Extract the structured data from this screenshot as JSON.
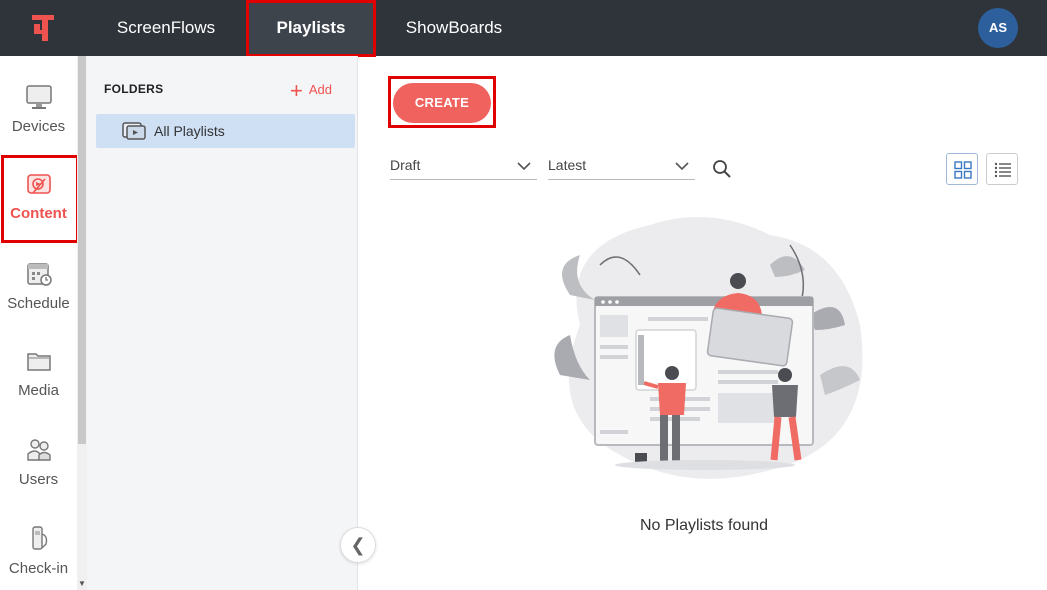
{
  "topbar": {
    "nav": [
      {
        "label": "ScreenFlows"
      },
      {
        "label": "Playlists"
      },
      {
        "label": "ShowBoards"
      }
    ],
    "avatar_initials": "AS"
  },
  "rail": {
    "items": [
      {
        "label": "Devices",
        "icon": "monitor-icon"
      },
      {
        "label": "Content",
        "icon": "content-icon"
      },
      {
        "label": "Schedule",
        "icon": "calendar-icon"
      },
      {
        "label": "Media",
        "icon": "folder-icon"
      },
      {
        "label": "Users",
        "icon": "users-icon"
      },
      {
        "label": "Check-in",
        "icon": "checkin-icon"
      }
    ],
    "active": "Content"
  },
  "folders": {
    "heading": "FOLDERS",
    "add_label": "Add",
    "items": [
      {
        "label": "All Playlists"
      }
    ]
  },
  "main": {
    "create_label": "CREATE",
    "status_filter": "Draft",
    "sort_filter": "Latest",
    "empty_message": "No Playlists found"
  },
  "colors": {
    "topbar": "#2f343b",
    "accent": "#ef5350",
    "selected_folder": "#cfe0f5",
    "avatar": "#2d5f9c"
  }
}
